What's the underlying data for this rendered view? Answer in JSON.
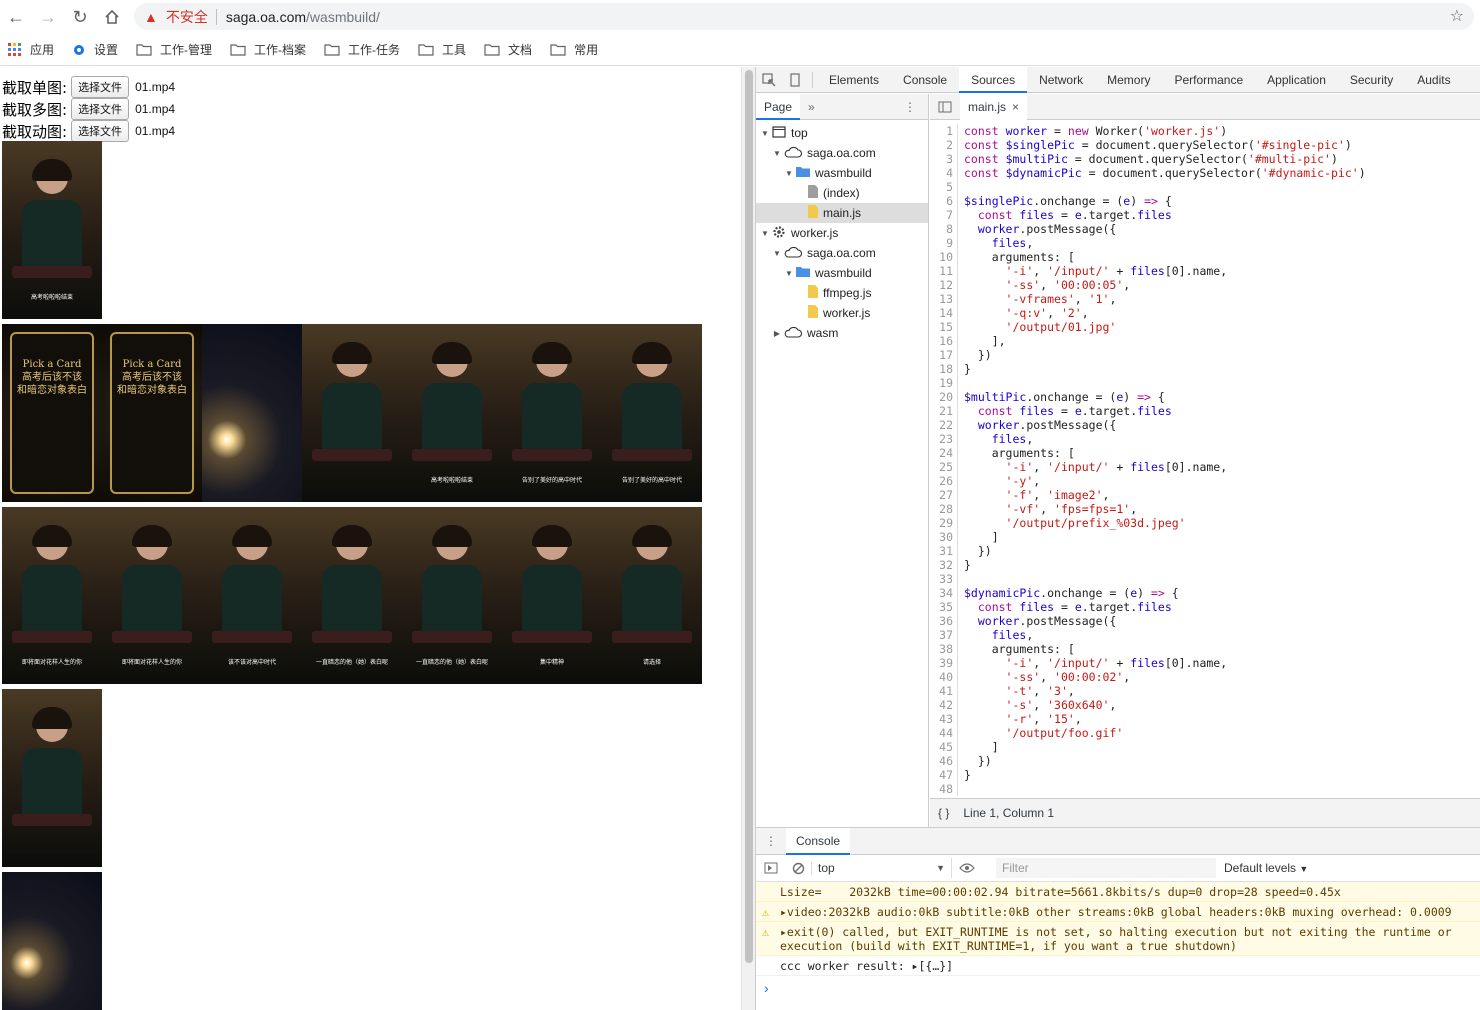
{
  "browser": {
    "insecure_label": "不安全",
    "url_host": "saga.oa.com",
    "url_path": "/wasmbuild/"
  },
  "bookmarks": [
    "应用",
    "设置",
    "工作-管理",
    "工作-档案",
    "工作-任务",
    "工具",
    "文档",
    "常用"
  ],
  "page": {
    "rows": [
      {
        "label": "截取单图:",
        "button": "选择文件",
        "file": "01.mp4"
      },
      {
        "label": "截取多图:",
        "button": "选择文件",
        "file": "01.mp4"
      },
      {
        "label": "截取动图:",
        "button": "选择文件",
        "file": "01.mp4"
      }
    ],
    "single_caption": "高考啦啦啦结束",
    "multi_row1_captions": [
      "Pick a Card\n高考后该不该\n和暗恋对象表白",
      "Pick a Card\n高考后该不该\n和暗恋对象表白",
      "",
      "",
      "高考啦啦啦结束",
      "告别了美好的高中时代",
      "告别了美好的高中时代"
    ],
    "multi_row2_captions": [
      "即将面对花样人生的你",
      "即将面对花样人生的你",
      "该不该对高中时代",
      "一直暗恋的他（她）表白呢",
      "一直暗恋的他（她）表白呢",
      "集中精神",
      "请选择"
    ]
  },
  "devtools": {
    "tabs": [
      "Elements",
      "Console",
      "Sources",
      "Network",
      "Memory",
      "Performance",
      "Application",
      "Security",
      "Audits"
    ],
    "active_tab": "Sources",
    "nav_tab": "Page",
    "tree": [
      {
        "label": "top",
        "depth": 0,
        "icon": "frame-icon",
        "open": true
      },
      {
        "label": "saga.oa.com",
        "depth": 1,
        "icon": "cloud-icon",
        "open": true
      },
      {
        "label": "wasmbuild",
        "depth": 2,
        "icon": "folder-icon",
        "open": true
      },
      {
        "label": "(index)",
        "depth": 3,
        "icon": "file-icon"
      },
      {
        "label": "main.js",
        "depth": 3,
        "icon": "js-file-icon",
        "selected": true
      },
      {
        "label": "worker.js",
        "depth": 0,
        "icon": "gear-icon",
        "open": true
      },
      {
        "label": "saga.oa.com",
        "depth": 1,
        "icon": "cloud-icon",
        "open": true
      },
      {
        "label": "wasmbuild",
        "depth": 2,
        "icon": "folder-icon",
        "open": true
      },
      {
        "label": "ffmpeg.js",
        "depth": 3,
        "icon": "js-file-icon"
      },
      {
        "label": "worker.js",
        "depth": 3,
        "icon": "js-file-icon"
      },
      {
        "label": "wasm",
        "depth": 1,
        "icon": "cloud-icon",
        "open": false
      }
    ],
    "editor_tab": "main.js",
    "code": [
      "const worker = new Worker('worker.js')",
      "const $singlePic = document.querySelector('#single-pic')",
      "const $multiPic = document.querySelector('#multi-pic')",
      "const $dynamicPic = document.querySelector('#dynamic-pic')",
      "",
      "$singlePic.onchange = (e) => {",
      "  const files = e.target.files",
      "  worker.postMessage({",
      "    files,",
      "    arguments: [",
      "      '-i', '/input/' + files[0].name,",
      "      '-ss', '00:00:05',",
      "      '-vframes', '1',",
      "      '-q:v', '2',",
      "      '/output/01.jpg'",
      "    ],",
      "  })",
      "}",
      "",
      "$multiPic.onchange = (e) => {",
      "  const files = e.target.files",
      "  worker.postMessage({",
      "    files,",
      "    arguments: [",
      "      '-i', '/input/' + files[0].name,",
      "      '-y',",
      "      '-f', 'image2',",
      "      '-vf', 'fps=fps=1',",
      "      '/output/prefix_%03d.jpeg'",
      "    ]",
      "  })",
      "}",
      "",
      "$dynamicPic.onchange = (e) => {",
      "  const files = e.target.files",
      "  worker.postMessage({",
      "    files,",
      "    arguments: [",
      "      '-i', '/input/' + files[0].name,",
      "      '-ss', '00:00:02',",
      "      '-t', '3',",
      "      '-s', '360x640',",
      "      '-r', '15',",
      "      '/output/foo.gif'",
      "    ]",
      "  })",
      "}",
      ""
    ],
    "status": "Line 1, Column 1",
    "console": {
      "tab": "Console",
      "context": "top",
      "filter_placeholder": "Filter",
      "levels": "Default levels",
      "messages": [
        {
          "type": "warn",
          "text": "Lsize=    2032kB time=00:00:02.94 bitrate=5661.8kbits/s dup=0 drop=28 speed=0.45x",
          "icon": false
        },
        {
          "type": "warn",
          "text": "▸video:2032kB audio:0kB subtitle:0kB other streams:0kB global headers:0kB muxing overhead: 0.0009",
          "icon": true
        },
        {
          "type": "warn",
          "text": "▸exit(0) called, but EXIT_RUNTIME is not set, so halting execution but not exiting the runtime or\nexecution (build with EXIT_RUNTIME=1, if you want a true shutdown)",
          "icon": true
        },
        {
          "type": "log",
          "text": "ccc worker result: ▸[{…}]",
          "icon": false
        }
      ]
    }
  }
}
